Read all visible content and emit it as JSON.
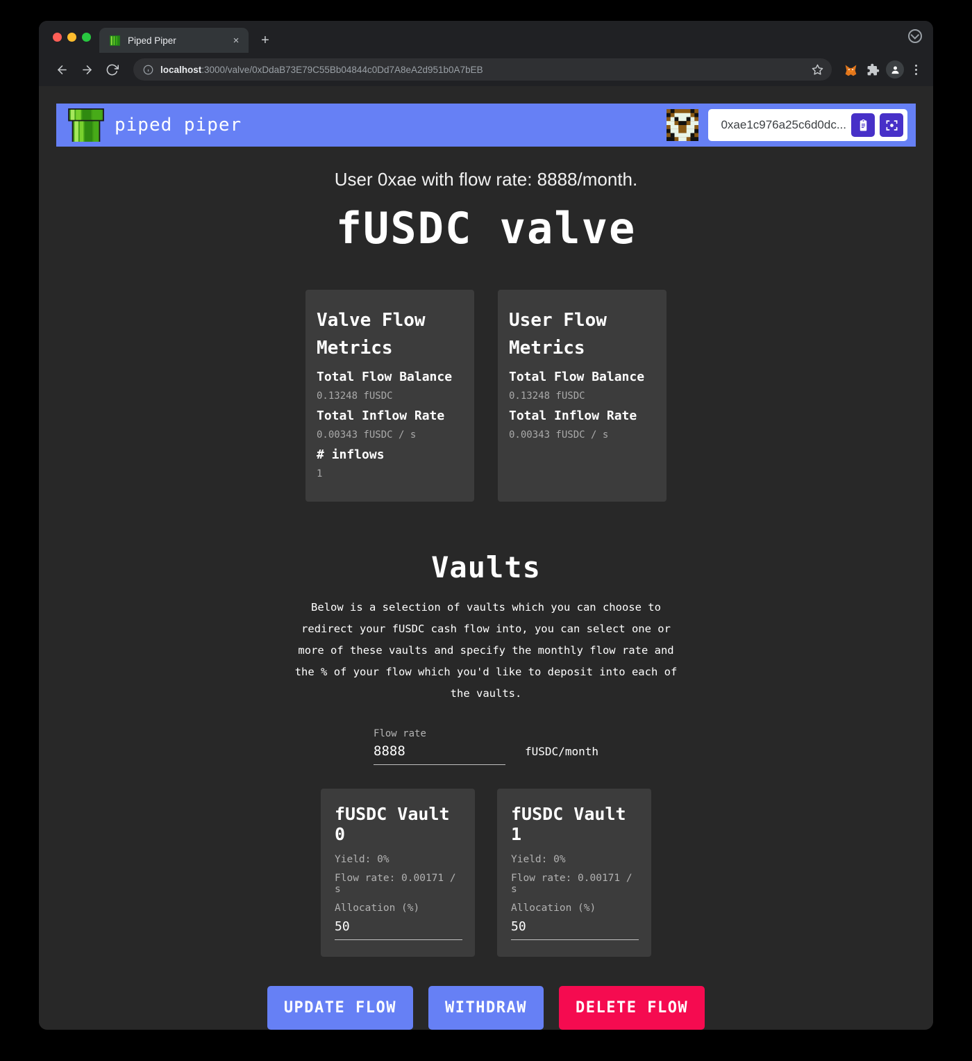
{
  "browser": {
    "tab_title": "Piped Piper",
    "tab_favicon": "pipe-icon",
    "close_label": "×",
    "new_tab_label": "+",
    "url_host": "localhost",
    "url_rest": ":3000/valve/0xDdaB73E79C55Bb04844c0Dd7A8eA2d951b0A7bEB",
    "back_label": "←",
    "forward_label": "→",
    "reload_label": "↻",
    "icons": {
      "info": "info-icon",
      "star": "star-icon",
      "metamask": "metamask-extension-icon",
      "extensions": "extensions-puzzle-icon",
      "profile": "profile-avatar-icon",
      "menu": "kebab-menu-icon"
    }
  },
  "app_header": {
    "brand": "piped piper",
    "logo": "green-pipe-logo",
    "avatar": "wallet-identicon",
    "wallet_address": "0xae1c976a25c6d0dc...",
    "copy_button": "copy-clipboard-icon",
    "scan_button": "qr-scan-icon"
  },
  "main": {
    "subtitle": "User 0xae with flow rate: 8888/month.",
    "title": "fUSDC valve",
    "metric_cards": [
      {
        "title": "Valve Flow Metrics",
        "rows": [
          {
            "label": "Total Flow Balance",
            "value": "0.13248 fUSDC"
          },
          {
            "label": "Total Inflow Rate",
            "value": "0.00343 fUSDC / s"
          },
          {
            "label": "# inflows",
            "value": "1"
          }
        ]
      },
      {
        "title": "User Flow Metrics",
        "rows": [
          {
            "label": "Total Flow Balance",
            "value": "0.13248 fUSDC"
          },
          {
            "label": "Total Inflow Rate",
            "value": "0.00343 fUSDC / s"
          }
        ]
      }
    ],
    "vaults_section": {
      "title": "Vaults",
      "description": "Below is a selection of vaults which you can choose to redirect your fUSDC cash flow into, you can select one or more of these vaults and specify the monthly flow rate and the % of your flow which you'd like to deposit into each of the vaults.",
      "flow_rate": {
        "label": "Flow rate",
        "value": "8888",
        "unit": "fUSDC/month"
      },
      "vaults": [
        {
          "name": "fUSDC Vault 0",
          "yield": "Yield: 0%",
          "flow_rate": "Flow rate: 0.00171 / s",
          "allocation_label": "Allocation (%)",
          "allocation_value": "50"
        },
        {
          "name": "fUSDC Vault 1",
          "yield": "Yield: 0%",
          "flow_rate": "Flow rate: 0.00171 / s",
          "allocation_label": "Allocation (%)",
          "allocation_value": "50"
        }
      ]
    },
    "actions": {
      "update": "UPDATE FLOW",
      "withdraw": "WITHDRAW",
      "delete": "DELETE FLOW"
    }
  },
  "colors": {
    "accent_blue": "#6680f5",
    "danger_red": "#f50b50",
    "chip_purple": "#4730c8",
    "page_bg": "#282828",
    "card_bg": "#3c3c3c"
  }
}
